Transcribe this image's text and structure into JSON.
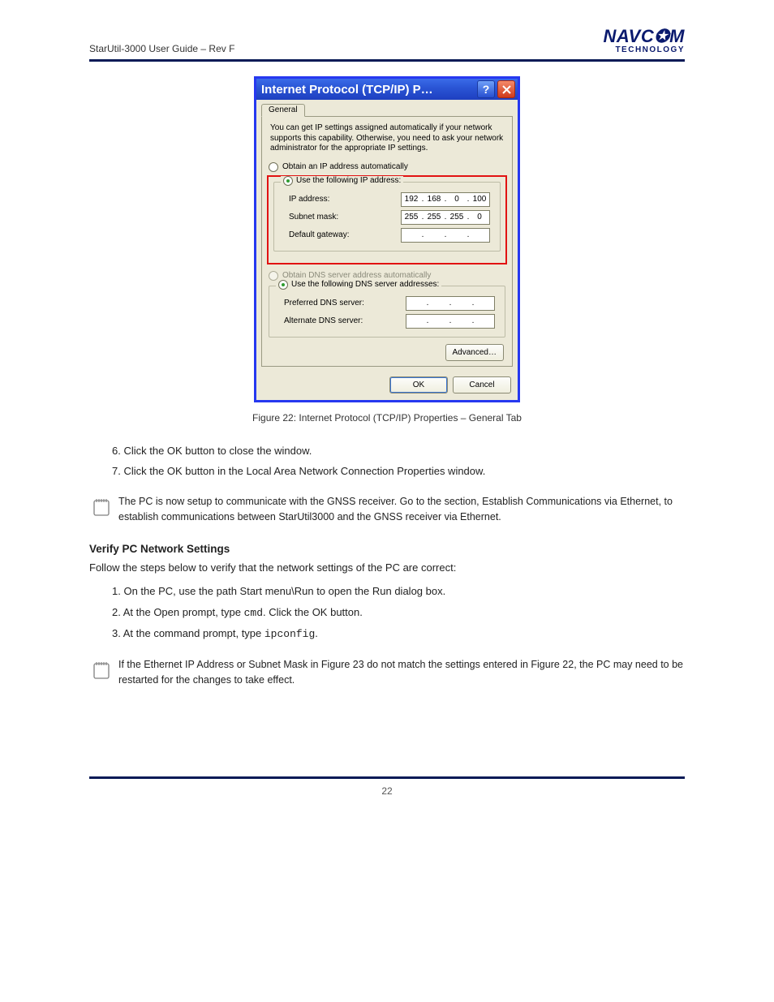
{
  "header": {
    "doc_title": "StarUtil-3000 User Guide – Rev F",
    "logo_top": "NAVC✪M",
    "logo_bot": "TECHNOLOGY"
  },
  "dialog": {
    "title": "Internet Protocol (TCP/IP) P…",
    "tab": "General",
    "info": "You can get IP settings assigned automatically if your network supports this capability. Otherwise, you need to ask your network administrator for the appropriate IP settings.",
    "opt_auto_ip": "Obtain an IP address automatically",
    "opt_use_ip": "Use the following IP address:",
    "lbl_ip": "IP address:",
    "lbl_mask": "Subnet mask:",
    "lbl_gw": "Default gateway:",
    "ip": {
      "o1": "192",
      "o2": "168",
      "o3": "0",
      "o4": "100"
    },
    "mask": {
      "o1": "255",
      "o2": "255",
      "o3": "255",
      "o4": "0"
    },
    "opt_auto_dns": "Obtain DNS server address automatically",
    "opt_use_dns": "Use the following DNS server addresses:",
    "lbl_pref_dns": "Preferred DNS server:",
    "lbl_alt_dns": "Alternate DNS server:",
    "btn_adv": "Advanced…",
    "btn_ok": "OK",
    "btn_cancel": "Cancel"
  },
  "caption": "Figure 22: Internet Protocol (TCP/IP) Properties – General Tab",
  "steps": {
    "s6": "6. Click the OK button to close the window.",
    "s7": "7. Click the OK button in the Local Area Network Connection Properties window."
  },
  "note1": "The PC is now setup to communicate with the GNSS receiver. Go to the section, Establish Communications via Ethernet, to establish communications between StarUtil3000 and the GNSS receiver via Ethernet.",
  "ver_heading": "Verify PC Network Settings",
  "ver_intro": "Follow the steps below  to verify that the network settings of the PC are correct:",
  "ver_steps": {
    "v1": "1. On the PC, use the path Start menu\\Run to open the Run dialog box.",
    "v2n": "2. At the Open prompt, type ",
    "v2cmd": "cmd",
    "v2rest": ". Click the OK button.",
    "v3": "3. At the command prompt, type ",
    "v3cmd": "ipconfig",
    "v3rest": "."
  },
  "note2": "If the Ethernet IP Address or Subnet Mask in Figure 23 do not match the settings entered in Figure 22, the PC may need to be restarted for the changes to take effect.",
  "page_num": "22"
}
